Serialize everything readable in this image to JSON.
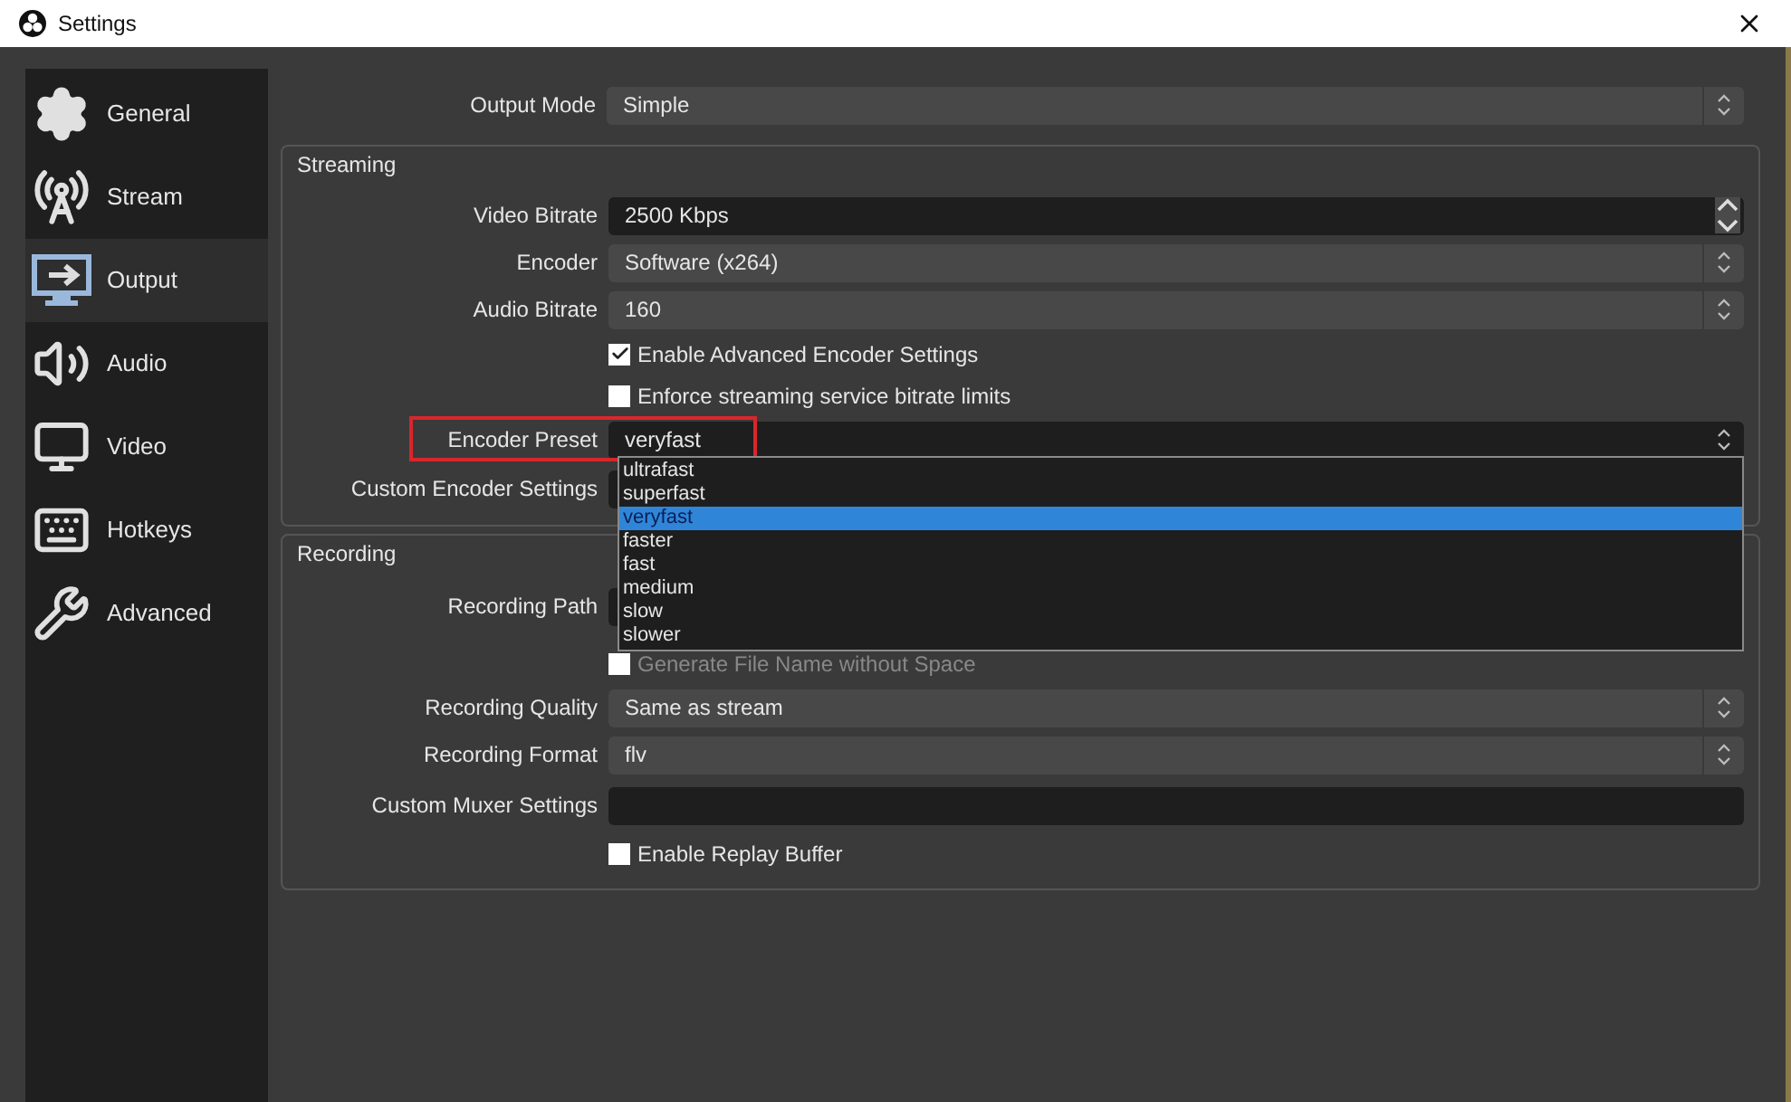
{
  "window": {
    "title": "Settings"
  },
  "sidebar": {
    "items": [
      {
        "label": "General",
        "selected": false
      },
      {
        "label": "Stream",
        "selected": false
      },
      {
        "label": "Output",
        "selected": true
      },
      {
        "label": "Audio",
        "selected": false
      },
      {
        "label": "Video",
        "selected": false
      },
      {
        "label": "Hotkeys",
        "selected": false
      },
      {
        "label": "Advanced",
        "selected": false
      }
    ]
  },
  "output_mode": {
    "label": "Output Mode",
    "value": "Simple"
  },
  "streaming": {
    "title": "Streaming",
    "rows": [
      {
        "kind": "spin",
        "label": "Video Bitrate",
        "value": "2500 Kbps"
      },
      {
        "kind": "select",
        "label": "Encoder",
        "value": "Software (x264)"
      },
      {
        "kind": "select",
        "label": "Audio Bitrate",
        "value": "160"
      },
      {
        "kind": "checkbox",
        "label": "Enable Advanced Encoder Settings",
        "checked": true
      },
      {
        "kind": "checkbox",
        "label": "Enforce streaming service bitrate limits",
        "checked": false
      },
      {
        "kind": "dropdown",
        "label": "Encoder Preset",
        "value": "veryfast",
        "highlighted": true,
        "options": [
          {
            "label": "ultrafast",
            "selected": false
          },
          {
            "label": "superfast",
            "selected": false
          },
          {
            "label": "veryfast",
            "selected": true
          },
          {
            "label": "faster",
            "selected": false
          },
          {
            "label": "fast",
            "selected": false
          },
          {
            "label": "medium",
            "selected": false
          },
          {
            "label": "slow",
            "selected": false
          },
          {
            "label": "slower",
            "selected": false
          }
        ]
      },
      {
        "kind": "covered",
        "label": "Custom Encoder Settings"
      }
    ]
  },
  "recording": {
    "title": "Recording",
    "rows": [
      {
        "kind": "covered",
        "label": "Recording Path"
      },
      {
        "kind": "partial",
        "label": "Generate File Name without Space",
        "checked": false
      },
      {
        "kind": "select",
        "label": "Recording Quality",
        "value": "Same as stream"
      },
      {
        "kind": "select",
        "label": "Recording Format",
        "value": "flv"
      },
      {
        "kind": "text",
        "label": "Custom Muxer Settings",
        "value": ""
      },
      {
        "kind": "checkbox",
        "label": "Enable Replay Buffer",
        "checked": false
      }
    ]
  }
}
